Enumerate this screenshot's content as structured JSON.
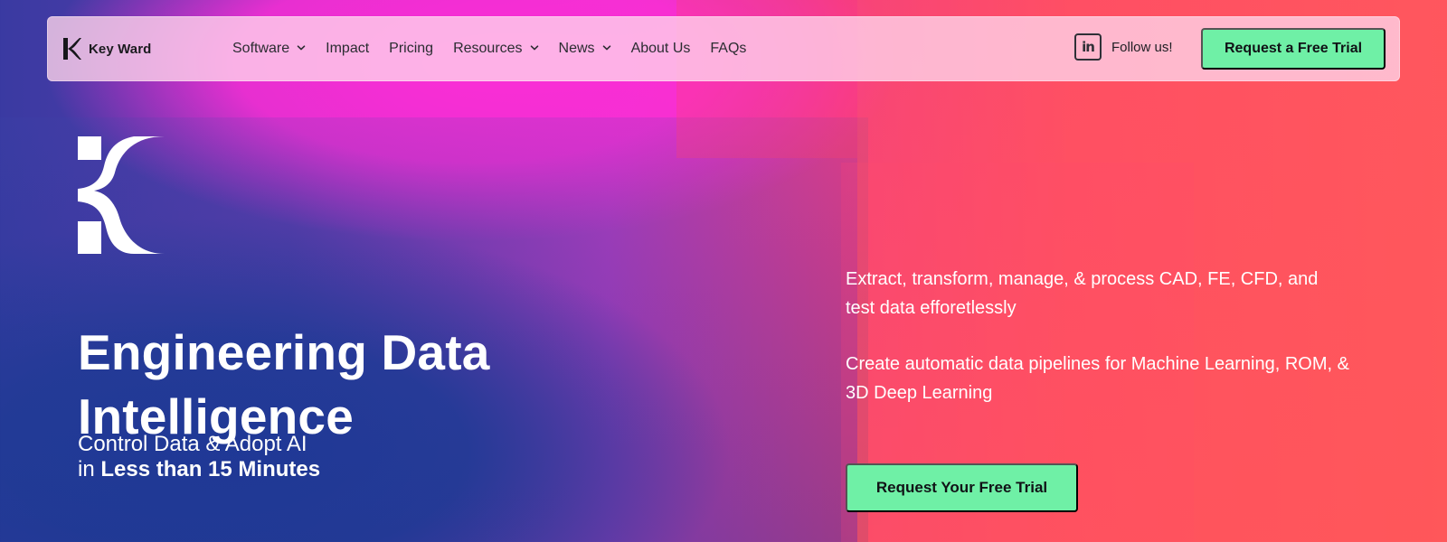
{
  "brand": {
    "name": "Key Ward"
  },
  "nav": {
    "items": [
      {
        "label": "Software",
        "has_chevron": true
      },
      {
        "label": "Impact",
        "has_chevron": false
      },
      {
        "label": "Pricing",
        "has_chevron": false
      },
      {
        "label": "Resources",
        "has_chevron": true
      },
      {
        "label": "News",
        "has_chevron": true
      },
      {
        "label": "About Us",
        "has_chevron": false
      },
      {
        "label": "FAQs",
        "has_chevron": false
      }
    ],
    "follow_label": "Follow us!",
    "linkedin_icon": "linkedin-icon",
    "cta_label": "Request a Free Trial"
  },
  "hero": {
    "headline_line1": "Engineering Data",
    "headline_line2": "Intelligence",
    "subline_line1": "Control Data & Adopt AI",
    "subline_prefix": "in ",
    "subline_emphasis": "Less than 15 Minutes",
    "right_copy_1": "Extract, transform, manage, & process CAD, FE, CFD, and test data efforetlessly",
    "right_copy_2": "Create automatic data pipelines for Machine Learning, ROM, & 3D Deep Learning",
    "cta_label": "Request Your Free Trial"
  },
  "colors": {
    "cta": "#6ff0a6",
    "nav_bg": "#ffd6ec",
    "text_dark": "#1b1b1f",
    "text_light": "#ffffff"
  }
}
